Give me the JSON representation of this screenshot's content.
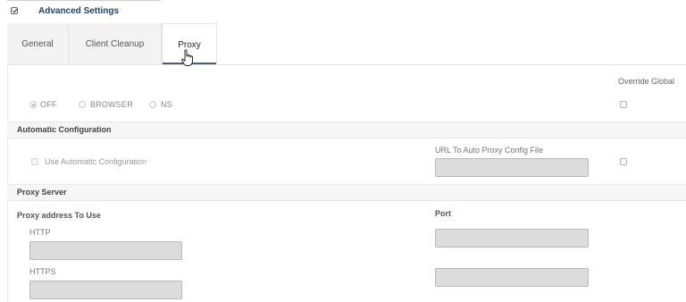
{
  "advanced_settings": {
    "label": "Advanced Settings",
    "checked": true
  },
  "tabs": [
    {
      "label": "General",
      "active": false
    },
    {
      "label": "Client Cleanup",
      "active": false
    },
    {
      "label": "Proxy",
      "active": true
    }
  ],
  "proxy_mode": {
    "override_label": "Override Global",
    "options": [
      {
        "label": "OFF",
        "selected": true
      },
      {
        "label": "BROWSER",
        "selected": false
      },
      {
        "label": "NS",
        "selected": false
      }
    ]
  },
  "automatic_configuration": {
    "title": "Automatic Configuration",
    "use_auto_label": "Use Automatic Configuration",
    "url_label": "URL To Auto Proxy Config File",
    "url_value": ""
  },
  "proxy_server": {
    "title": "Proxy Server",
    "address_label": "Proxy address To Use",
    "port_label": "Port",
    "http_label": "HTTP",
    "https_label": "HTTPS",
    "http_value": "",
    "http_port": "",
    "https_value": "",
    "https_port": ""
  },
  "icons": [
    "checkbox-checked-icon",
    "hand-pointer-cursor-icon"
  ]
}
